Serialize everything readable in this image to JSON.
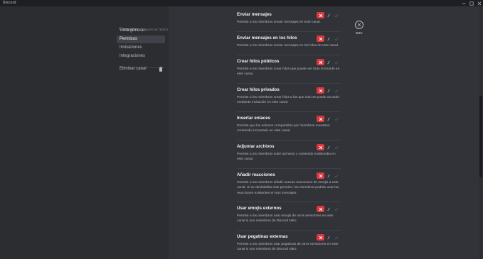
{
  "app": {
    "title": "Discord"
  },
  "sidebar": {
    "header": {
      "channel": "EVENTOS",
      "type": "CANALES DE TEXTO"
    },
    "items": [
      {
        "label": "Vista general"
      },
      {
        "label": "Permisos"
      },
      {
        "label": "Invitaciones"
      },
      {
        "label": "Integraciones"
      },
      {
        "label": "Eliminar canal"
      }
    ]
  },
  "esc": {
    "label": "ESC"
  },
  "permissions": [
    {
      "title": "Enviar mensajes",
      "desc": "Permite a los miembros enviar mensajes en este canal.",
      "state": "deny"
    },
    {
      "title": "Enviar mensajes en los hilos",
      "desc": "Permite a los miembros enviar mensajes en los hilos de este canal.",
      "state": "deny"
    },
    {
      "title": "Crear hilos públicos",
      "desc": "Permite a los miembros crear hilos que puede ver todo el mundo en este canal.",
      "state": "deny"
    },
    {
      "title": "Crear hilos privados",
      "desc": "Permite a los miembros crear hilos a los que solo se puede acceder mediante invitación en este canal.",
      "state": "deny"
    },
    {
      "title": "Insertar enlaces",
      "desc": "Permite que los enlaces compartidos por miembros muestren contenido incrustado en este canal.",
      "state": "deny"
    },
    {
      "title": "Adjuntar archivos",
      "desc": "Permite a los miembros subir archivos o contenido multimedia en este canal.",
      "state": "deny"
    },
    {
      "title": "Añadir reacciones",
      "desc": "Permite a los miembros añadir nuevas reacciones de emojis a este canal. Si se deshabilita este permiso, los miembros podrán usar las reacciones existentes en sus mensajes.",
      "state": "deny"
    },
    {
      "title": "Usar emojis externos",
      "desc": "Permite a los miembros usar emojis de otros servidores en este canal si son miembros de Discord Nitro.",
      "state": "deny"
    },
    {
      "title": "Usar pegatinas externas",
      "desc": "Permite a los miembros usar pegatinas de otros servidores en este canal si son miembros de Discord Nitro.",
      "state": "deny"
    }
  ]
}
